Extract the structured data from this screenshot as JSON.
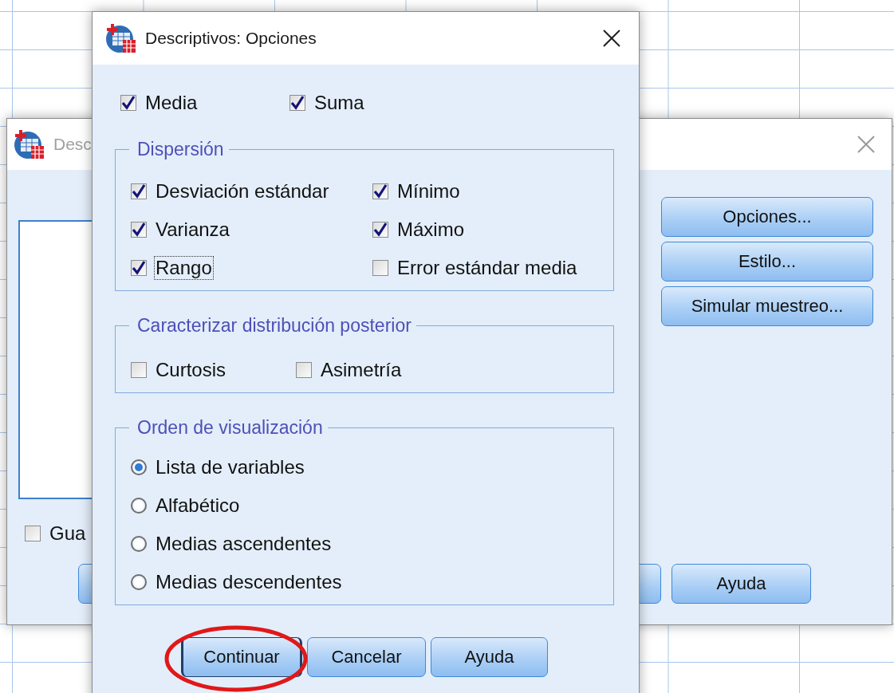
{
  "background_dialog": {
    "title": "Desc",
    "side_buttons": [
      {
        "label": "Opciones..."
      },
      {
        "label": "Estilo..."
      },
      {
        "label": "Simular muestreo..."
      }
    ],
    "save_option": {
      "label": "Gua",
      "checked": false
    },
    "bottom_buttons": [
      {
        "kind": "covered"
      },
      {
        "kind": "covered"
      },
      {
        "kind": "labeled",
        "label": "Ayuda"
      }
    ]
  },
  "dialog": {
    "title": "Descriptivos: Opciones",
    "top_options": [
      {
        "label": "Media",
        "checked": true
      },
      {
        "label": "Suma",
        "checked": true
      }
    ],
    "groups": [
      {
        "title": "Dispersión",
        "kind": "checkboxes",
        "items": [
          {
            "label": "Desviación estándar",
            "checked": true,
            "focused": false
          },
          {
            "label": "Mínimo",
            "checked": true,
            "focused": false
          },
          {
            "label": "Varianza",
            "checked": true,
            "focused": false
          },
          {
            "label": "Máximo",
            "checked": true,
            "focused": false
          },
          {
            "label": "Rango",
            "checked": true,
            "focused": true
          },
          {
            "label": "Error estándar media",
            "checked": false,
            "focused": false
          }
        ]
      },
      {
        "title": "Caracterizar distribución posterior",
        "kind": "checkboxes",
        "items": [
          {
            "label": "Curtosis",
            "checked": false
          },
          {
            "label": "Asimetría",
            "checked": false
          }
        ]
      },
      {
        "title": "Orden de visualización",
        "kind": "radios",
        "items": [
          {
            "label": "Lista de variables",
            "selected": true
          },
          {
            "label": "Alfabético",
            "selected": false
          },
          {
            "label": "Medias ascendentes",
            "selected": false
          },
          {
            "label": "Medias descendentes",
            "selected": false
          }
        ]
      }
    ],
    "buttons": [
      {
        "label": "Continuar",
        "default": true
      },
      {
        "label": "Cancelar",
        "default": false
      },
      {
        "label": "Ayuda",
        "default": false
      }
    ]
  }
}
